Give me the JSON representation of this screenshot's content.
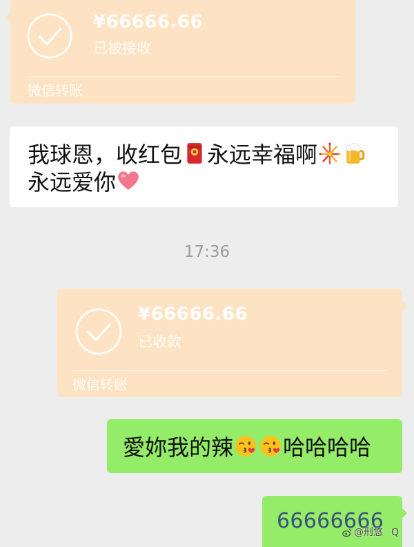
{
  "colors": {
    "background": "#ededed",
    "incoming_bubble": "#ffffff",
    "outgoing_bubble": "#95ec69",
    "transfer_card": "#fde3c3",
    "timestamp": "#9c9c9c",
    "number_link": "#3a5279"
  },
  "messages": [
    {
      "type": "transfer",
      "direction": "incoming",
      "icon": "check-circle-icon",
      "amount": "¥66666.66",
      "status": "已被接收",
      "footer": "微信转账"
    },
    {
      "type": "text",
      "direction": "incoming",
      "lines": [
        [
          {
            "text": "我球恩，收红包"
          },
          {
            "icon": "red-envelope-icon"
          },
          {
            "text": "永远幸福啊"
          },
          {
            "icon": "fireworks-icon"
          },
          {
            "icon": "beer-mug-icon"
          }
        ],
        [
          {
            "text": "永远爱你"
          },
          {
            "icon": "pink-heart-icon"
          }
        ]
      ]
    },
    {
      "type": "time",
      "text": "17:36"
    },
    {
      "type": "transfer",
      "direction": "outgoing",
      "icon": "check-circle-icon",
      "amount": "¥66666.66",
      "status": "已收款",
      "footer": "微信转账"
    },
    {
      "type": "text",
      "direction": "outgoing",
      "segments": [
        {
          "text": "愛妳我的辣"
        },
        {
          "icon": "kissing-face-icon"
        },
        {
          "icon": "kissing-face-icon"
        },
        {
          "text": "哈哈哈哈"
        }
      ]
    },
    {
      "type": "text",
      "direction": "outgoing",
      "text": "66666666"
    }
  ],
  "watermark": {
    "icon": "weibo-icon",
    "text": "@刑悠",
    "extra": "Q"
  }
}
